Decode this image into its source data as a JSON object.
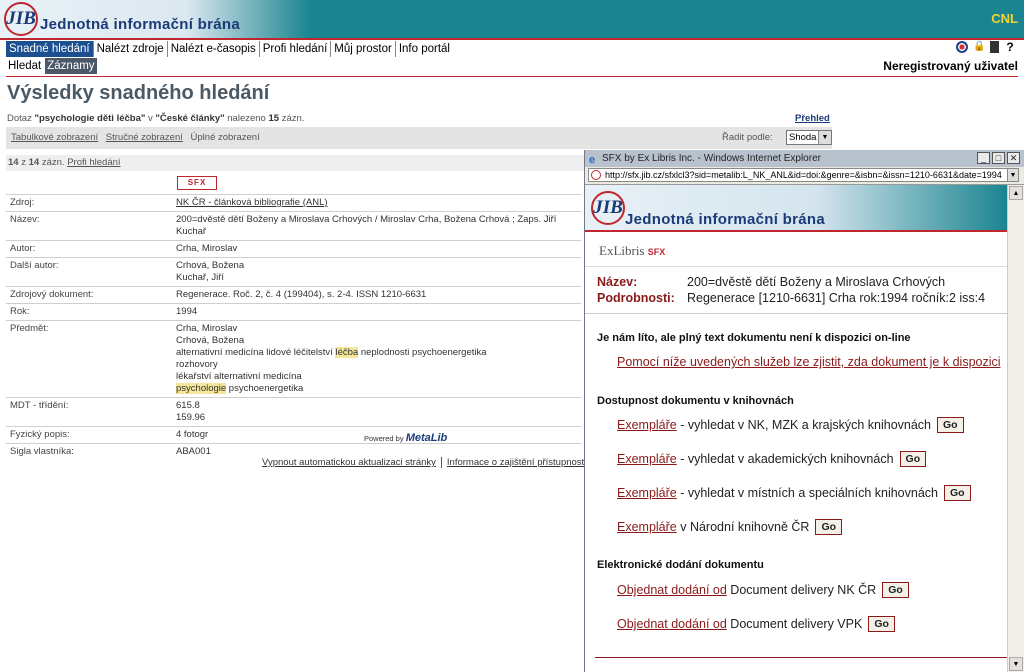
{
  "header": {
    "logo_abbr": "JIB",
    "logo_text": "Jednotná informační brána",
    "org": "CNL"
  },
  "nav": {
    "items": [
      "Snadné hledání",
      "Nalézt zdroje",
      "Nalézt e-časopis",
      "Profi hledání",
      "Můj prostor",
      "Info portál"
    ],
    "sub": [
      "Hledat",
      "Záznamy"
    ],
    "user": "Neregistrovaný uživatel"
  },
  "page": {
    "title": "Výsledky snadného hledání",
    "query_prefix": "Dotaz",
    "query_text": "\"psychologie děti léčba\"",
    "query_in": "v",
    "query_base": "\"České články\"",
    "query_found": "nalezeno",
    "query_count": "15",
    "query_suffix": "zázn.",
    "overview": "Přehled",
    "views": [
      "Tabulkové zobrazení",
      "Stručné zobrazení",
      "Úplné zobrazení"
    ],
    "sort_label": "Řadit podle:",
    "sort_value": "Shoda",
    "count_current": "14",
    "count_of": "z",
    "count_total": "14",
    "count_unit": "zázn.",
    "pro_search": "Profi hledání",
    "sfx": "SFX"
  },
  "record": {
    "source_label": "Zdroj:",
    "source_value": "NK ČR - článková bibliografie (ANL)",
    "name_label": "Název:",
    "name_value": "200=dvěstě dětí Boženy a Miroslava Crhových  / Miroslav Crha, Božena Crhová ; Zaps. Jiří Kuchař",
    "author_label": "Autor:",
    "author_value": "Crha, Miroslav",
    "other_author_label": "Další autor:",
    "other_author_1": "Crhová, Božena",
    "other_author_2": "Kuchař, Jiří",
    "source_doc_label": "Zdrojový dokument:",
    "source_doc_value": "Regenerace. Roč. 2, č. 4 (199404), s. 2-4. ISSN 1210-6631",
    "year_label": "Rok:",
    "year_value": "1994",
    "subject_label": "Předmět:",
    "subject_1": "Crha, Miroslav",
    "subject_2": "Crhová, Božena",
    "subject_3a": "alternativní medicína lidové léčitelství ",
    "subject_3hl": "léčba",
    "subject_3b": " neplodnosti psychoenergetika",
    "subject_4": "rozhovory",
    "subject_5": "lékařství alternativní medicína",
    "subject_6hl": "psychologie",
    "subject_6b": " psychoenergetika",
    "mdt_label": "MDT - třídění:",
    "mdt_1": "615.8",
    "mdt_2": "159.96",
    "phys_label": "Fyzický popis:",
    "phys_value": "4 fotogr",
    "sigla_label": "Sigla vlastníka:",
    "sigla_value": "ABA001"
  },
  "footer": {
    "powered_by": "Powered by",
    "metalib": "MetaLib",
    "link1": "Vypnout automatickou aktualizaci stránky",
    "link2": "Informace o zajištění přístupnosti"
  },
  "popup": {
    "window_title": "SFX by Ex Libris Inc. - Windows Internet Explorer",
    "url": "http://sfx.jib.cz/sfxlcl3?sid=metalib:L_NK_ANL&id=doi:&genre=&isbn=&issn=1210-6631&date=1994",
    "exlibris": "ExLibris",
    "sfx": "SFX",
    "name_label": "Název:",
    "name_value": "200=dvěstě dětí Boženy a Miroslava Crhových",
    "details_label": "Podrobnosti:",
    "details_value": "Regenerace [1210-6631] Crha rok:1994 ročník:2 iss:4",
    "sorry_title": "Je nám líto, ale plný text dokumentu není k dispozici on-line",
    "sorry_link": "Pomocí níže uvedených služeb lze zjistit, zda dokument je k dispozici",
    "avail_title": "Dostupnost dokumentu v knihovnách",
    "services": [
      {
        "link": "Exempláře",
        "text": " - vyhledat v NK, MZK a krajských knihovnách"
      },
      {
        "link": "Exempláře",
        "text": " - vyhledat v akademických knihovnách"
      },
      {
        "link": "Exempláře",
        "text": " - vyhledat v místních a speciálních knihovnách"
      },
      {
        "link": "Exempláře",
        "text": " v Národní knihovně ČR"
      }
    ],
    "edelivery_title": "Elektronické dodání dokumentu",
    "delivery": [
      {
        "link": "Objednat dodání od",
        "text": " Document delivery NK ČR"
      },
      {
        "link": "Objednat dodání od",
        "text": " Document delivery VPK"
      }
    ],
    "go": "Go"
  }
}
